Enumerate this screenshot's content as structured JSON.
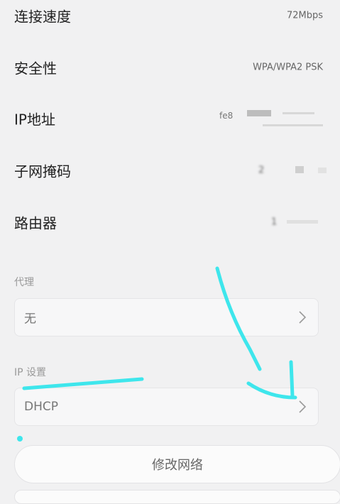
{
  "rows": [
    {
      "label": "连接速度",
      "value": "72Mbps"
    },
    {
      "label": "安全性",
      "value": "WPA/WPA2 PSK"
    },
    {
      "label": "IP地址",
      "value": "fe8"
    },
    {
      "label": "子网掩码",
      "value": "2"
    },
    {
      "label": "路由器",
      "value": "1"
    }
  ],
  "proxy": {
    "section_title": "代理",
    "value": "无"
  },
  "ip_settings": {
    "section_title": "IP 设置",
    "value": "DHCP"
  },
  "buttons": {
    "modify_network": "修改网络"
  },
  "annotation": {
    "color": "#3ee6ec"
  },
  "icons": {
    "chevron": "chevron-right-icon"
  }
}
